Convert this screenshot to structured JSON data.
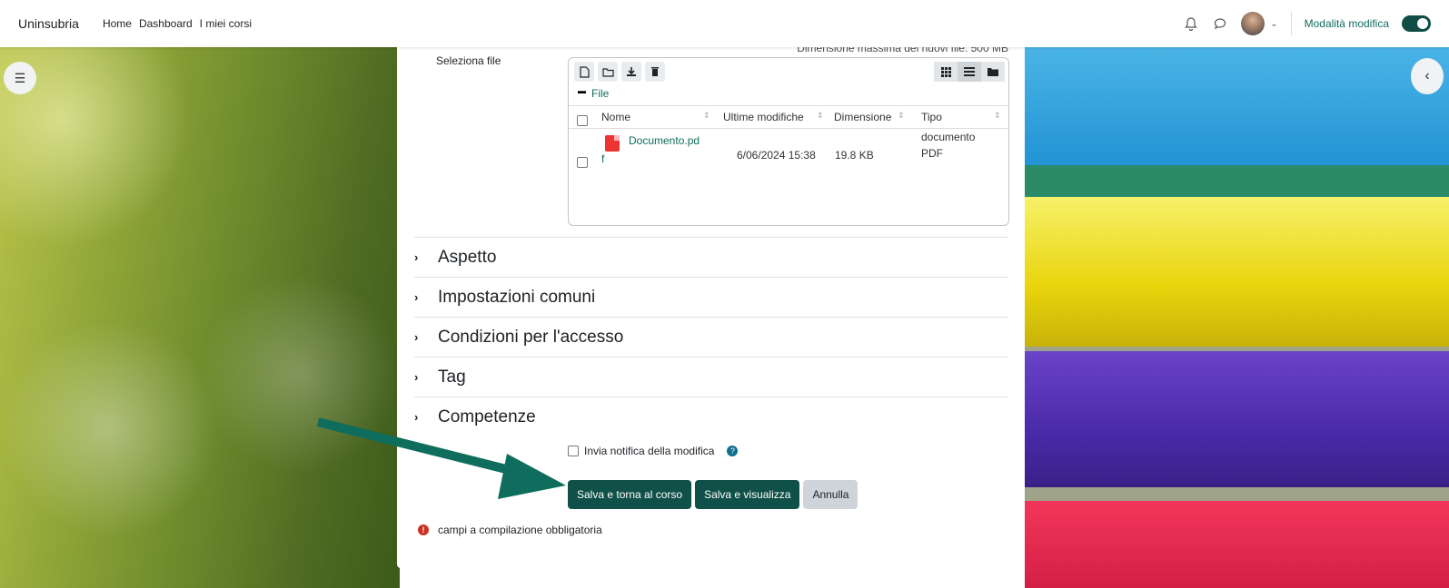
{
  "navbar": {
    "brand": "Uninsubria",
    "links": [
      "Home",
      "Dashboard",
      "I miei corsi"
    ],
    "edit_mode_label": "Modalità modifica"
  },
  "form": {
    "select_file_label": "Seleziona file",
    "max_size_label": "Dimensione massima dei nuovi file: 500 MB",
    "file_manager": {
      "path": "File",
      "columns": [
        "Nome",
        "Ultime modifiche",
        "Dimensione",
        "Tipo"
      ],
      "files": [
        {
          "name_line1": "Documento.pd",
          "name_line2": "f",
          "modified": "6/06/2024 15:38",
          "size": "19.8 KB",
          "type_line1": "documento",
          "type_line2": "PDF"
        }
      ]
    },
    "sections": [
      "Aspetto",
      "Impostazioni comuni",
      "Condizioni per l'accesso",
      "Tag",
      "Competenze"
    ],
    "notify_label": "Invia notifica della modifica",
    "buttons": {
      "save_return": "Salva e torna al corso",
      "save_view": "Salva e visualizza",
      "cancel": "Annulla"
    },
    "required_label": "campi a compilazione obbligatoria"
  },
  "colors": {
    "primary": "#0f5048",
    "link": "#0f6d5d",
    "arrow": "#0f6d5d",
    "required": "#ca3120"
  }
}
